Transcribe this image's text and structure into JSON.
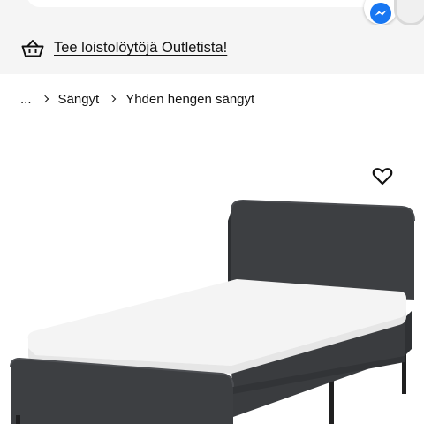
{
  "header": {
    "messenger_icon": "messenger-icon"
  },
  "promo": {
    "icon": "shopping-basket-icon",
    "text": "Tee loistolöytöjä Outletista!"
  },
  "breadcrumb": {
    "ellipsis": "...",
    "items": [
      "Sängyt",
      "Yhden hengen sängyt"
    ]
  },
  "product": {
    "favourite_icon": "heart-outline-icon",
    "image_alt": "bed-photo"
  },
  "colors": {
    "banner_bg": "#f5f5f5",
    "messenger_blue": "#1877f2",
    "fabric": "#3d3f42",
    "mattress": "#f4f4f4"
  }
}
